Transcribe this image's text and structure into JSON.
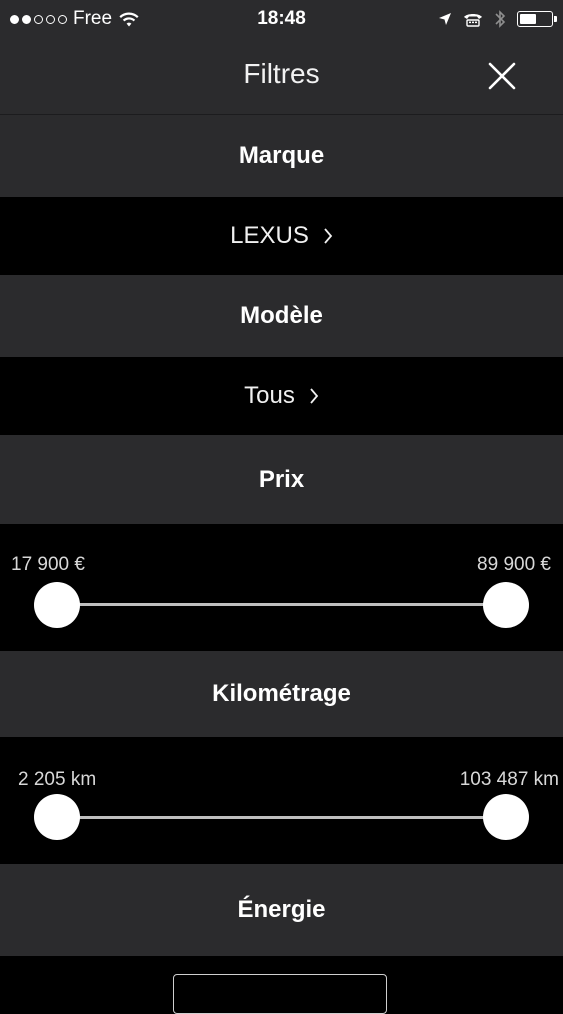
{
  "status_bar": {
    "carrier": "Free",
    "time": "18:48",
    "signal_dots_filled": 2,
    "signal_dots_total": 5,
    "battery_level": 0.55,
    "icons": [
      "wifi-icon",
      "location-arrow-icon",
      "tty-icon",
      "bluetooth-icon",
      "battery-icon"
    ]
  },
  "nav": {
    "title": "Filtres",
    "close_icon": "close-icon"
  },
  "sections": {
    "brand": {
      "header": "Marque",
      "value": "LEXUS"
    },
    "model": {
      "header": "Modèle",
      "value": "Tous"
    },
    "price": {
      "header": "Prix",
      "min_label": "17 900 €",
      "max_label": "89 900 €",
      "low": 0.0,
      "high": 1.0
    },
    "mileage": {
      "header": "Kilométrage",
      "min_label": "2 205 km",
      "max_label": "103 487 km",
      "low": 0.0,
      "high": 1.0
    },
    "energy": {
      "header": "Énergie"
    }
  },
  "colors": {
    "bar_bg": "#2b2b2d",
    "row_bg": "#000000",
    "text": "#ffffff",
    "track": "#bfbfbf"
  }
}
